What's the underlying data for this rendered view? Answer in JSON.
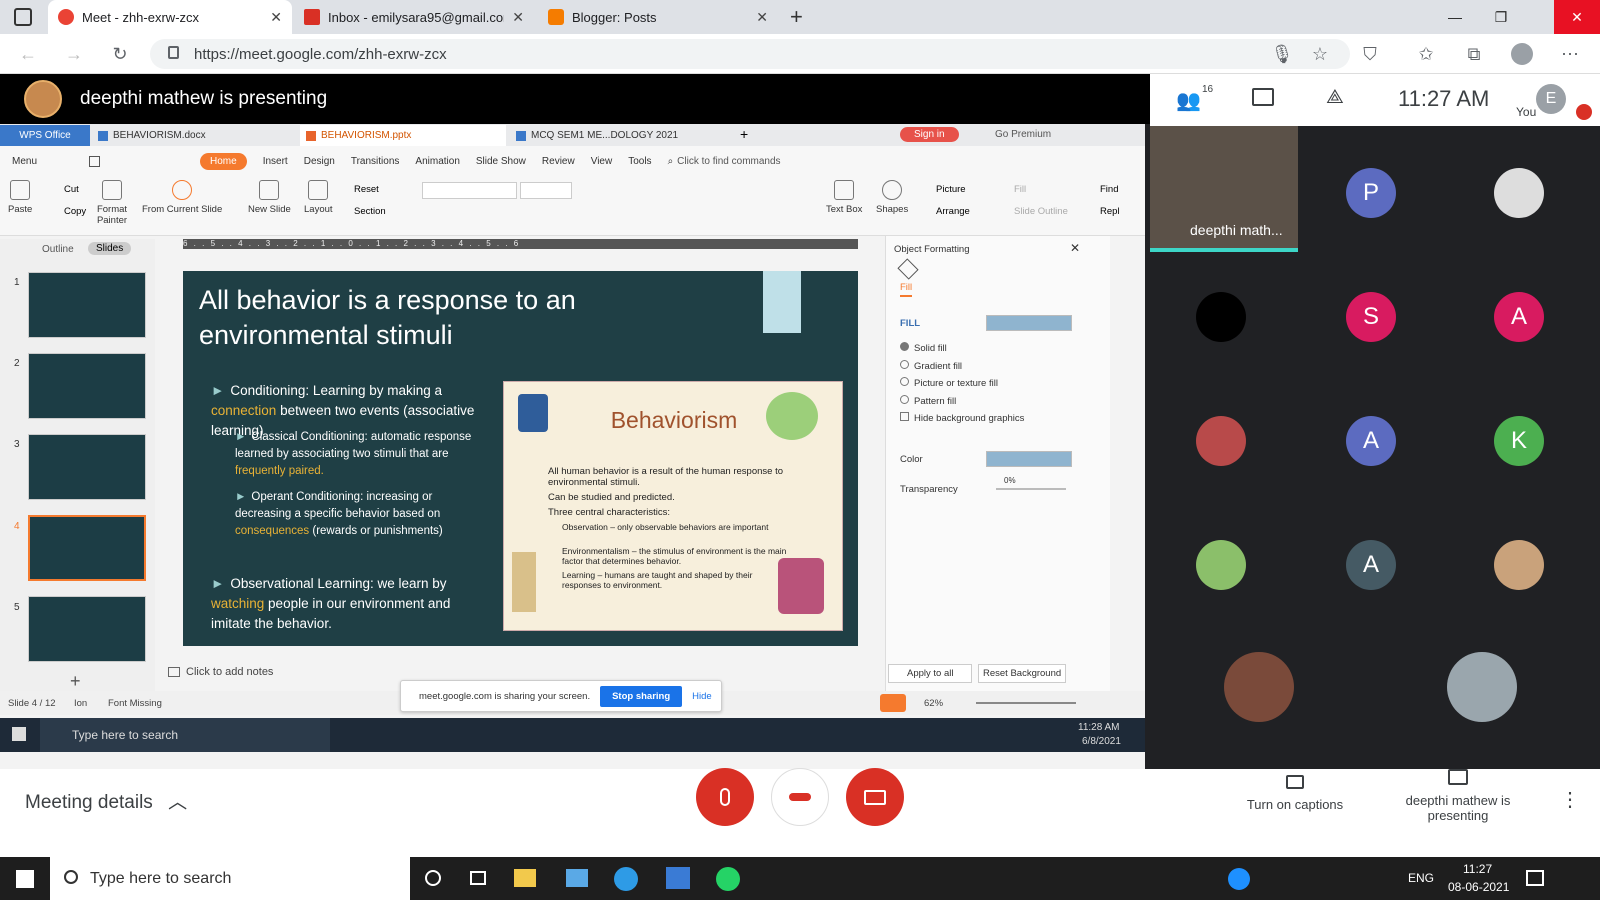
{
  "browser": {
    "tabs": [
      {
        "label": "Meet - zhh-exrw-zcx",
        "color": "#ea4335"
      },
      {
        "label": "Inbox - emilysara95@gmail.com",
        "color": "#d93025"
      },
      {
        "label": "Blogger: Posts",
        "color": "#f57c00"
      }
    ],
    "new_tab": "+",
    "url": "https://meet.google.com/zhh-exrw-zcx",
    "window_controls": [
      "—",
      "❐",
      "✕"
    ]
  },
  "meet": {
    "presenting_title": "deepthi mathew is presenting",
    "participant_count": "16",
    "clock": "11:27 AM",
    "you_label": "You",
    "you_initial": "E",
    "video_tile_name": "deepthi math..."
  },
  "wps": {
    "tabs": [
      "WPS Office",
      "BEHAVIORISM.docx",
      "BEHAVIORISM.pptx",
      "MCQ SEM1 ME...DOLOGY 2021"
    ],
    "sign_in": "Sign in",
    "go_premium": "Go Premium",
    "menu": [
      "Menu",
      "Home",
      "Insert",
      "Design",
      "Transitions",
      "Animation",
      "Slide Show",
      "Review",
      "View",
      "Tools"
    ],
    "find_commands": "Click to find commands",
    "ribbon": {
      "paste": "Paste",
      "cut": "Cut",
      "copy": "Copy",
      "format_painter": "Format Painter",
      "from_current_slide": "From Current Slide",
      "new_slide": "New Slide",
      "layout": "Layout",
      "reset": "Reset",
      "section": "Section",
      "text_box": "Text Box",
      "shapes": "Shapes",
      "picture": "Picture",
      "arrange": "Arrange",
      "fill": "Fill",
      "slide_outline": "Slide Outline",
      "find": "Find",
      "replace": "Repl"
    },
    "pane_tabs": [
      "Outline",
      "Slides"
    ],
    "thumbnails": [
      "1",
      "2",
      "3",
      "4",
      "5"
    ],
    "ruler": "6 . . 5 . . 4 . . 3 . . 2 . . 1 . . 0 . . 1 . . 2 . . 3 . . 4 . . 5 . . 6",
    "notes_placeholder": "Click to add notes",
    "status": {
      "slide": "Slide 4 / 12",
      "theme": "Ion",
      "font_missing": "Font Missing",
      "zoom": "62%"
    }
  },
  "slide": {
    "title": "All behavior is a response to an environmental stimuli",
    "b1_pre": "Conditioning: Learning by making a ",
    "b1_hl": "connection",
    "b1_post": " between two events (associative learning)",
    "s1_pre": "Classical Conditioning: automatic response learned by associating two stimuli that are ",
    "s1_hl": "frequently paired.",
    "s2_pre": "Operant Conditioning: increasing or decreasing a specific behavior based on ",
    "s2_hl": "consequences",
    "s2_post": " (rewards or punishments)",
    "b2_pre": "Observational Learning: we learn by ",
    "b2_hl": "watching",
    "b2_post": " people in our environment and imitate the behavior.",
    "inner_title": "Behaviorism",
    "inner_items": [
      "All human behavior is a result of the human response to environmental stimuli.",
      "Can be studied and predicted.",
      "Three central characteristics:"
    ],
    "inner_sub": [
      "Observation – only observable behaviors are important",
      "Environmentalism – the stimulus of environment is the main factor that determines behavior.",
      "Learning – humans are taught and shaped by their responses to environment."
    ]
  },
  "format_panel": {
    "title": "Object Formatting",
    "fill_tab": "Fill",
    "section": "FILL",
    "options": [
      "Solid fill",
      "Gradient fill",
      "Picture or texture fill",
      "Pattern fill"
    ],
    "hide_bg": "Hide background graphics",
    "color_label": "Color",
    "transparency_label": "Transparency",
    "transparency_value": "0%",
    "apply_all": "Apply to all",
    "reset_bg": "Reset Background",
    "swatch_color": "#8fb4cf"
  },
  "sharing": {
    "message": "meet.google.com is sharing your screen.",
    "stop": "Stop sharing",
    "hide": "Hide"
  },
  "inner_taskbar": {
    "search": "Type here to search",
    "time": "11:28 AM",
    "date": "6/8/2021"
  },
  "participants": [
    {
      "initial": "P",
      "color": "#5c6bc0"
    },
    {
      "initial": "S",
      "color": "#d81b60"
    },
    {
      "initial": "A",
      "color": "#d81b60"
    },
    {
      "initial": "A",
      "color": "#5c6bc0"
    },
    {
      "initial": "K",
      "color": "#4caf50"
    },
    {
      "initial": "A",
      "color": "#455a64"
    }
  ],
  "controls": {
    "meeting_details": "Meeting details",
    "captions": "Turn on captions",
    "presenting": "deepthi mathew is presenting"
  },
  "taskbar": {
    "search": "Type here to search",
    "lang": "ENG",
    "time": "11:27",
    "date": "08-06-2021"
  }
}
